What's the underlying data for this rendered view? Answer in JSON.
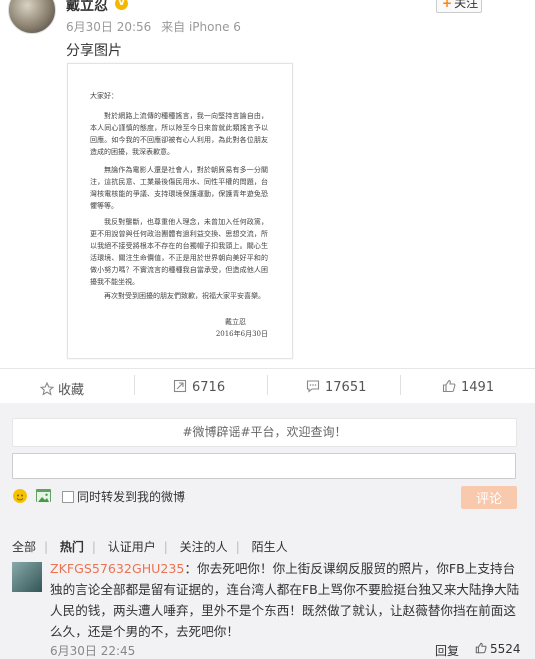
{
  "post": {
    "username": "戴立忍",
    "verified_badge": "V",
    "follow_label": "关注",
    "time": "6月30日 20:56",
    "source": "来自 iPhone 6",
    "text": "分享图片"
  },
  "document": {
    "greeting": "大家好：",
    "para1": "對於網路上流傳的種種謠言，我一向堅持言論自由，本人同心謹慎的態度，所以除至今日來曾就此類謠言予以回應。如今我的不回應卻被有心人利用，為此對各位朋友造成的困擾，我深表歉意。",
    "para2": "無論作為電影人還是社會人，對於朝貿易有多一分關注，這抗民意、工業最後傷民用水、同性平權的問題，台灣核電核能的爭議、支持環境保護運動，保護青年遊免恐懼等等。",
    "para3": "我反對壟斷，也尊重他人理念，未曾加入任何政黨，更不用說曾與任何政治團體有過利益交換、思想交流，所以我絕不接受將根本不存在的台獨帽子扣我頭上。關心生活環境、關注生命價值，不正是用於世界朝向美好平和的做小努力嗎？不實流言的種種我自當承受，但造成他人困擾我不能坐視。",
    "para4": "再次對受到困擾的朋友們致歉，祝福大家平安喜樂。",
    "signature": "戴立忍",
    "date": "2016年6月30日"
  },
  "actions": {
    "favorite_label": "收藏",
    "repost_count": "6716",
    "comment_count": "17651",
    "like_count": "1491"
  },
  "comments": {
    "notice": "#微博辟谣#平台，欢迎查询！",
    "input_value": "",
    "repost_checkbox_label": "同时转发到我的微博",
    "submit_label": "评论",
    "filters": [
      "全部",
      "热门",
      "认证用户",
      "关注的人",
      "陌生人"
    ],
    "items": [
      {
        "user": "ZKFGS57632GHU235",
        "text": "：你去死吧你！你上街反课纲反服贸的照片，你FB上支持台独的言论全部都是留有证据的，连台湾人都在FB上骂你不要脸挺台独又来大陆挣大陆人民的钱，两头遭人唾弃，里外不是个东西！既然做了就认，让赵薇替你挡在前面这么久，还是个男的不，去死吧你！",
        "time": "6月30日 22:45",
        "reply_label": "回复",
        "likes": "5524"
      }
    ]
  },
  "colors": {
    "accent_orange": "#ff8200",
    "username_link": "#eb7350",
    "submit_disabled": "#f9c9ae",
    "comment_area_bg": "#f2f2f5"
  },
  "icons": [
    "verified-badge-icon",
    "plus-icon",
    "star-icon",
    "repost-icon",
    "comment-icon",
    "like-icon",
    "emoji-icon",
    "picture-icon",
    "thumbs-up-icon"
  ]
}
